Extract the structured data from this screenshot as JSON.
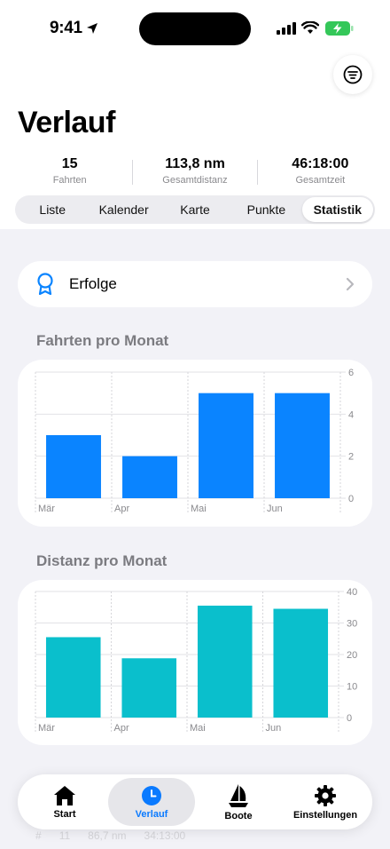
{
  "status": {
    "time": "9:41"
  },
  "header": {
    "title": "Verlauf"
  },
  "stats": [
    {
      "value": "15",
      "label": "Fahrten"
    },
    {
      "value": "113,8 nm",
      "label": "Gesamtdistanz"
    },
    {
      "value": "46:18:00",
      "label": "Gesamtzeit"
    }
  ],
  "segments": [
    "Liste",
    "Kalender",
    "Karte",
    "Punkte",
    "Statistik"
  ],
  "selected_segment": "Statistik",
  "erfolge": {
    "label": "Erfolge"
  },
  "colors": {
    "accent": "#0a84ff",
    "trips_bar": "#0a84ff",
    "distance_bar": "#0abfcc"
  },
  "chart_data": [
    {
      "type": "bar",
      "title": "Fahrten pro Monat",
      "categories": [
        "Mär",
        "Apr",
        "Mai",
        "Jun"
      ],
      "values": [
        3,
        2,
        5,
        5
      ],
      "ylim": [
        0,
        6
      ],
      "yticks": [
        0,
        2,
        4,
        6
      ],
      "grid": true
    },
    {
      "type": "bar",
      "title": "Distanz pro Monat",
      "categories": [
        "Mär",
        "Apr",
        "Mai",
        "Jun"
      ],
      "values": [
        25.5,
        18.8,
        35.5,
        34.5
      ],
      "ylim": [
        0,
        40
      ],
      "yticks": [
        0,
        10,
        20,
        30,
        40
      ],
      "grid": true
    }
  ],
  "background_row": {
    "count": "11",
    "distance": "86,7 nm",
    "time": "34:13:00"
  },
  "tabs": [
    {
      "label": "Start",
      "icon": "house-icon"
    },
    {
      "label": "Verlauf",
      "icon": "clock-icon"
    },
    {
      "label": "Boote",
      "icon": "sailboat-icon"
    },
    {
      "label": "Einstellungen",
      "icon": "gear-icon"
    }
  ],
  "active_tab": "Verlauf"
}
